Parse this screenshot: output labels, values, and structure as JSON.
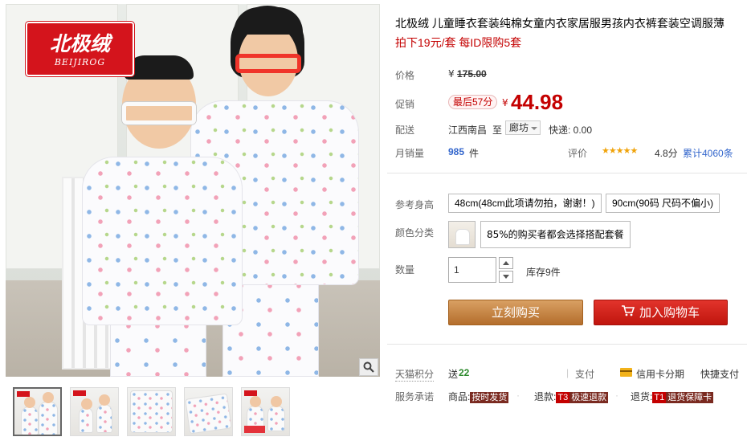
{
  "brand": {
    "logo_cn": "北极绒",
    "logo_en": "BEIJIROG"
  },
  "gallery": {
    "thumbnail_count": 5
  },
  "product": {
    "title": "北极绒 儿童睡衣套装纯棉女童内衣家居服男孩内衣裤套装空调服薄",
    "subtitle": "拍下19元/套 每ID限购5套"
  },
  "price_panel": {
    "price_label": "价格",
    "yen": "¥",
    "original_price": "175.00",
    "promo_label": "促销",
    "promo_tag": "最后57分",
    "promo_price": "44.98",
    "ship_label": "配送",
    "ship_from": "江西南昌",
    "ship_to_word": "至",
    "ship_to": "廊坊",
    "ship_fee": "快递: 0.00",
    "sales_label": "月销量",
    "sales_count": "985",
    "sales_unit": "件",
    "rating_label": "评价",
    "stars": "★★★★★",
    "rating_score": "4.8分",
    "review_count": "累计4060条"
  },
  "options": {
    "height_label": "参考身高",
    "height_options": [
      "48cm(48cm此项请勿拍，谢谢！)",
      "90cm(90码 尺码不偏小)"
    ],
    "color_label": "颜色分类",
    "color_option": "85%的购买者都会选择搭配套餐",
    "qty_label": "数量",
    "qty_value": "1",
    "stock": "库存9件"
  },
  "actions": {
    "buy_now": "立刻购买",
    "add_to_cart": "加入购物车"
  },
  "footer": {
    "points_label": "天猫积分",
    "points_prefix": "送",
    "points_value": "22",
    "pay_label": "支付",
    "credit_installment": "信用卡分期",
    "quick_pay": "快捷支付",
    "service_label": "服务承诺",
    "goods_label": "商品:",
    "goods_tag": "按时发货",
    "refund_label": "退款:",
    "refund_num": "T3",
    "refund_tag": "极速退款",
    "return_label": "退货:",
    "return_num": "T1",
    "return_tag": "退货保障卡"
  },
  "colors": {
    "price_red": "#c40000",
    "buy_orange": "#c8853f",
    "cart_red": "#d2231b",
    "link_blue": "#3366cc",
    "star_gold": "#f0a30a"
  }
}
